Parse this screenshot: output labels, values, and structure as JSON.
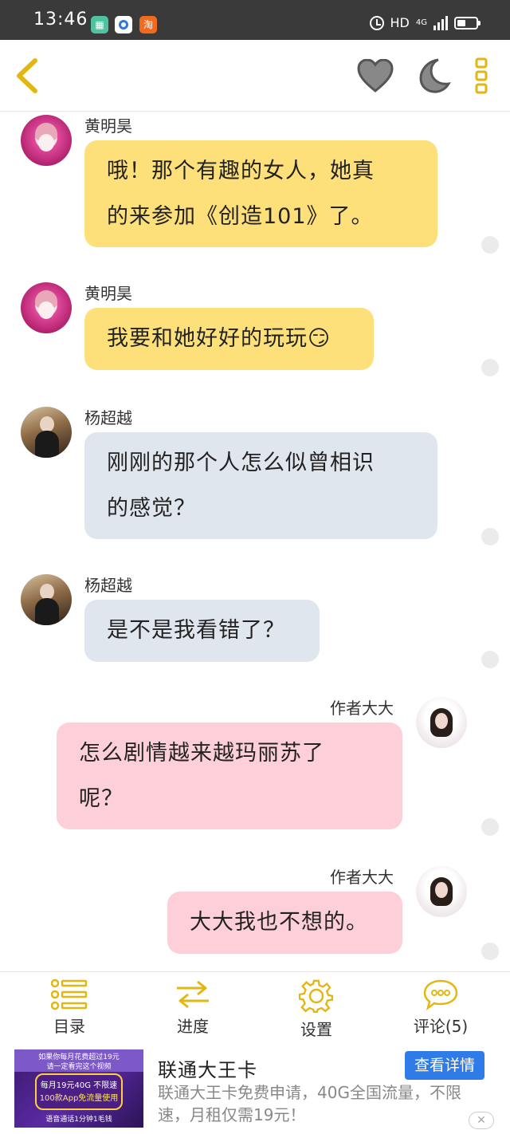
{
  "status_bar": {
    "time": "13:46",
    "app_icons": [
      "calendar-app-icon",
      "browser-app-icon",
      "taobao-app-icon"
    ],
    "taobao_glyph": "淘",
    "network": "HD",
    "network_type": "4G"
  },
  "messages": [
    {
      "sender": "黄明昊",
      "avatar": "huang-avatar",
      "side": "left",
      "color": "yellow",
      "lines": [
        "哦！那个有趣的女人，她真",
        "的来参加《创造101》了。"
      ]
    },
    {
      "sender": "黄明昊",
      "avatar": "huang-avatar",
      "side": "left",
      "color": "yellow",
      "lines": [
        "我要和她好好的玩玩😏"
      ]
    },
    {
      "sender": "杨超越",
      "avatar": "yang-avatar",
      "side": "left",
      "color": "gray",
      "lines": [
        "刚刚的那个人怎么似曾相识",
        "的感觉？"
      ]
    },
    {
      "sender": "杨超越",
      "avatar": "yang-avatar",
      "side": "left",
      "color": "gray",
      "lines": [
        "是不是我看错了？"
      ]
    },
    {
      "sender": "作者大大",
      "avatar": "author-avatar",
      "side": "right",
      "color": "pink",
      "lines": [
        "怎么剧情越来越玛丽苏了",
        "呢？"
      ]
    },
    {
      "sender": "作者大大",
      "avatar": "author-avatar",
      "side": "right",
      "color": "pink",
      "lines": [
        "大大我也不想的。"
      ]
    }
  ],
  "toolbar": {
    "catalog": "目录",
    "progress": "进度",
    "settings": "设置",
    "comments": "评论(5)"
  },
  "ad": {
    "title": "联通大王卡",
    "button": "查看详情",
    "description": "联通大王卡免费申请，40G全国流量，不限速，月租仅需19元！",
    "close": "✕",
    "image_text": {
      "line1": "如果你每月花费超过19元",
      "line2": "请一定看完这个视频",
      "line3": "每月19元40G 不限速",
      "line4": "100款App免流量使用",
      "line5": "语音通话1分钟1毛钱"
    }
  },
  "colors": {
    "yellow_bubble": "#fde07a",
    "gray_bubble": "#e0e6ee",
    "pink_bubble": "#fdcfd9",
    "accent": "#f0c419",
    "ad_button": "#2f7ce8"
  }
}
